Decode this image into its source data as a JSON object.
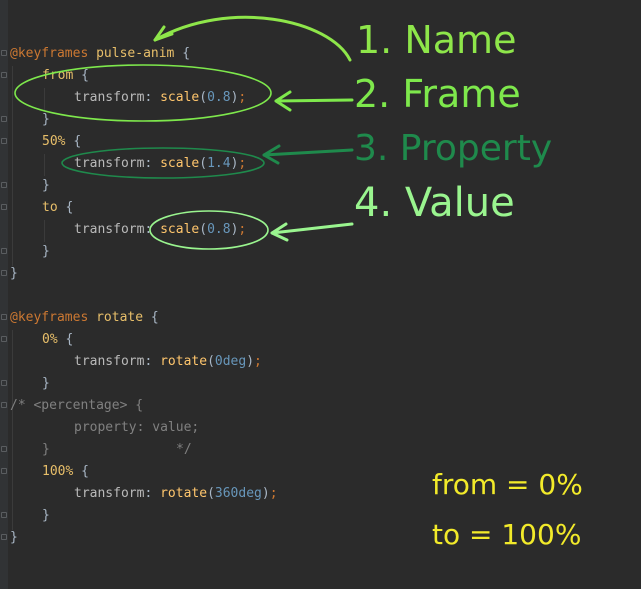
{
  "code": {
    "l1": {
      "kw": "@keyframes",
      "name": "pulse-anim",
      "brace": "{"
    },
    "l2": {
      "sel": "from",
      "brace": "{"
    },
    "l3": {
      "prop": "transform",
      "colon": ":",
      "fn": "scale",
      "arg": "0.8"
    },
    "l4": "}",
    "l5": {
      "sel": "50%",
      "brace": "{"
    },
    "l6": {
      "prop": "transform",
      "colon": ":",
      "fn": "scale",
      "arg": "1.4"
    },
    "l7": "}",
    "l8": {
      "sel": "to",
      "brace": "{"
    },
    "l9": {
      "prop": "transform",
      "colon": ":",
      "fn": "scale",
      "arg": "0.8"
    },
    "l10": "}",
    "l11": "}",
    "l13": {
      "kw": "@keyframes",
      "name": "rotate",
      "brace": "{"
    },
    "l14": {
      "sel": "0%",
      "brace": "{"
    },
    "l15": {
      "prop": "transform",
      "colon": ":",
      "fn": "rotate",
      "num": "0",
      "unit": "deg"
    },
    "l16": "}",
    "l17": "/* <percentage> {",
    "l18": "property: value;",
    "l19": "}",
    "l19b": "*/",
    "l20": {
      "sel": "100%",
      "brace": "{"
    },
    "l21": {
      "prop": "transform",
      "colon": ":",
      "fn": "rotate",
      "num": "360",
      "unit": "deg"
    },
    "l22": "}",
    "l23": "}"
  },
  "annotations": {
    "name": "1. Name",
    "frame": "2. Frame",
    "property": "3. Property",
    "value": "4. Value",
    "from_eq": "from = 0%",
    "to_eq": "to = 100%"
  },
  "colors": {
    "light_green": "#8ee64a",
    "green": "#7ee84c",
    "dark_green": "#1f8a4c",
    "mint": "#9af58f",
    "yellow": "#f2ea2a"
  }
}
